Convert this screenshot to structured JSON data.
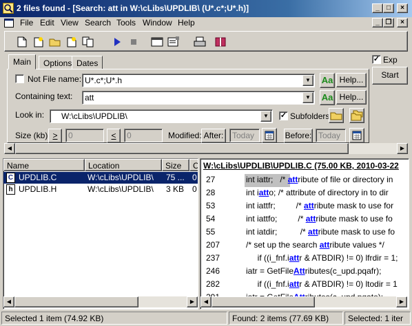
{
  "window": {
    "title": "2 files found - [Search: att in W:\\cLibs\\UPDLIB\\ (U*.c*;U*.h)]"
  },
  "menu": [
    "File",
    "Edit",
    "View",
    "Search",
    "Tools",
    "Window",
    "Help"
  ],
  "toolbar": {
    "buttons": [
      "new-icon",
      "new-search-icon",
      "open-icon",
      "save-icon",
      "copy-icon",
      "run-icon",
      "stop-icon",
      "window-icon",
      "properties-icon",
      "print-icon",
      "book-icon"
    ]
  },
  "tabs": [
    "Main",
    "Options",
    "Dates"
  ],
  "main": {
    "not_label": "Not",
    "file_name_label": "File name:",
    "file_name_value": "U*.c*;U*.h",
    "containing_label": "Containing text:",
    "containing_value": "att",
    "help_label": "Help...",
    "look_in_label": "Look in:",
    "look_in_value": "W:\\cLibs\\UPDLIB\\",
    "subfolders_label": "Subfolders",
    "size_label": "Size (kb):",
    "size_gt": ">",
    "size_lt": "<",
    "size_min_value": "0",
    "size_max_value": "0",
    "modified_label": "Modified:",
    "after_label": "After:",
    "after_value": "Today",
    "before_label": "Before:",
    "before_value": "Today"
  },
  "right_panel": {
    "expand_label": "Exp",
    "start_label": "Start"
  },
  "list": {
    "columns": [
      "Name",
      "Location",
      "Size",
      "C"
    ],
    "rows": [
      {
        "icon": "c-file-icon",
        "name": "UPDLIB.C",
        "location": "W:\\cLibs\\UPDLIB\\",
        "size": "75 ...",
        "c": "0"
      },
      {
        "icon": "h-file-icon",
        "name": "UPDLIB.H",
        "location": "W:\\cLibs\\UPDLIB\\",
        "size": "3 KB",
        "c": "0"
      }
    ]
  },
  "preview": {
    "header": "W:\\cLibs\\UPDLIB\\UPDLIB.C  (75.00 KB,  2010-03-22",
    "lines": [
      {
        "num": "27",
        "before": "int iattr;   /* ",
        "match": "att",
        "after": "ribute of file or directory in"
      },
      {
        "num": "28",
        "before": "int i",
        "match": "att",
        "after": "o;   /* attribute of directory in to dir"
      },
      {
        "num": "53",
        "before": "int iattfr;         /* ",
        "match": "att",
        "after": "ribute mask to use for"
      },
      {
        "num": "54",
        "before": "int iattfo;         /* ",
        "match": "att",
        "after": "ribute mask to use fo"
      },
      {
        "num": "55",
        "before": "int iatdir;          /* ",
        "match": "att",
        "after": "ribute mask to use fo"
      },
      {
        "num": "207",
        "before": "/* set up the search ",
        "match": "att",
        "after": "ribute values */"
      },
      {
        "num": "237",
        "before": "     if ((i_fnf.i",
        "match": "att",
        "after": "r & ATBDIR) != 0) lfrdir = 1;"
      },
      {
        "num": "246",
        "before": "iatr = GetFile",
        "match": "Att",
        "after": "ributes(c_upd.pqafr);"
      },
      {
        "num": "282",
        "before": "     if ((i_fnf.i",
        "match": "att",
        "after": "r & ATBDIR) != 0) ltodir = 1"
      },
      {
        "num": "291",
        "before": "iatr = GetFile",
        "match": "Att",
        "after": "ributes(c_upd.pqato);"
      }
    ]
  },
  "status": {
    "left": "Selected 1 item (74.92 KB)",
    "middle": "Found: 2 items (77.69 KB)",
    "right": "Selected: 1 iter"
  }
}
